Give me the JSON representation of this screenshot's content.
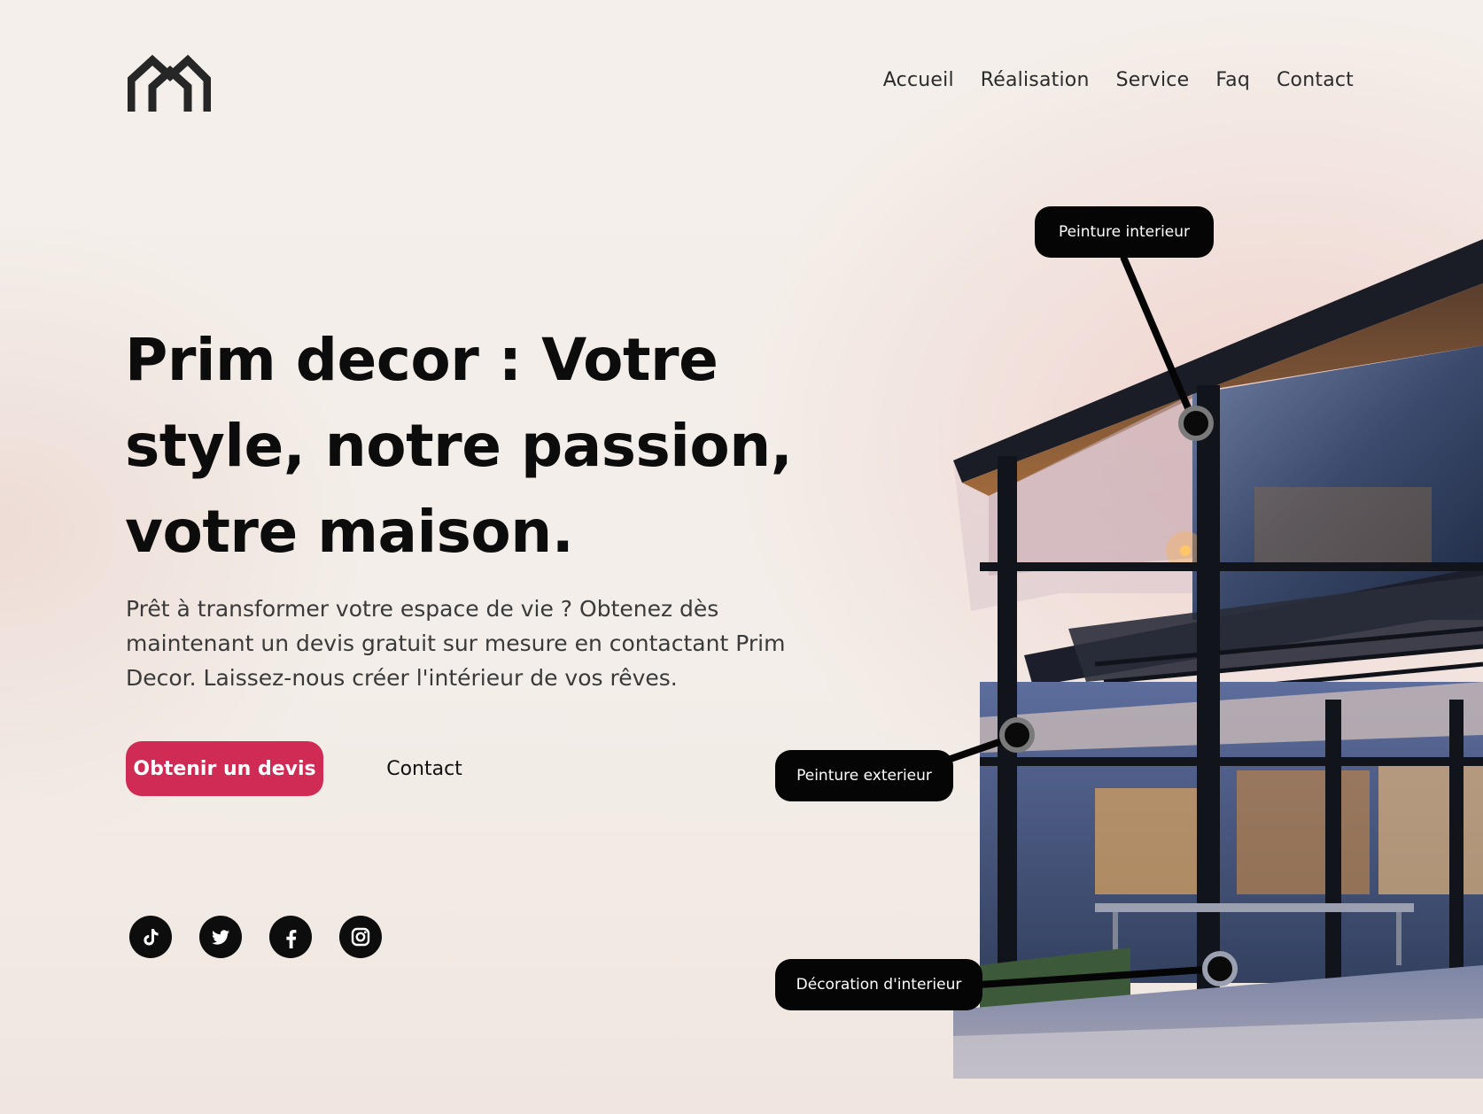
{
  "brand": {
    "logo_icon": "house-m-logo-icon"
  },
  "nav": {
    "items": [
      "Accueil",
      "Réalisation",
      "Service",
      "Faq",
      "Contact"
    ]
  },
  "hero": {
    "title": "Prim decor : Votre style, notre passion, votre maison.",
    "subtitle": "Prêt à transformer votre espace de vie ? Obtenez dès maintenant un devis gratuit sur mesure en contactant Prim Decor. Laissez-nous créer l'intérieur de vos rêves.",
    "primary_button": "Obtenir un devis",
    "secondary_button": "Contact"
  },
  "socials": [
    "tiktok-icon",
    "twitter-icon",
    "facebook-icon",
    "instagram-icon"
  ],
  "tags": {
    "interior_paint": "Peinture interieur",
    "exterior_paint": "Peinture exterieur",
    "decoration": "Décoration d'interieur"
  },
  "colors": {
    "accent": "#d02b55",
    "dark": "#050505",
    "background": "#f4efea"
  }
}
